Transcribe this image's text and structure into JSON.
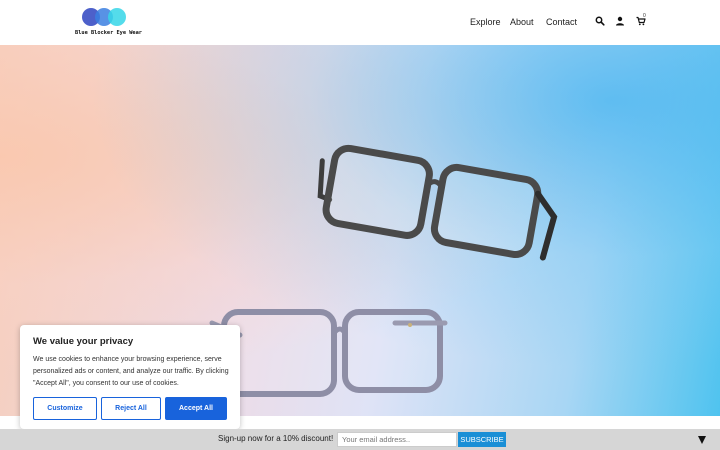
{
  "brand": {
    "logo_text": "Blue Blocker Eye Wear"
  },
  "nav": {
    "items": [
      "Explore",
      "About",
      "Contact"
    ],
    "cart_count": "0"
  },
  "icons": {
    "search": "search-icon",
    "user": "user-icon",
    "cart": "cart-icon",
    "collapse": "caret-down-icon"
  },
  "hero": {
    "image": "two pairs of clear eyeglasses on pastel gradient background"
  },
  "cookie": {
    "title": "We value your privacy",
    "text": "We use cookies to enhance your browsing experience, serve personalized ads or content, and analyze our traffic. By clicking \"Accept All\", you consent to our use of cookies.",
    "customize_label": "Customize",
    "reject_label": "Reject All",
    "accept_label": "Accept All"
  },
  "signup": {
    "text": "Sign-up now for a 10% discount!",
    "placeholder": "Your email address..",
    "button_label": "SUBSCRIBE"
  },
  "colors": {
    "accent": "#1863dc",
    "subscribe": "#1a8fd6",
    "signup_bar": "#d6d6d6"
  }
}
